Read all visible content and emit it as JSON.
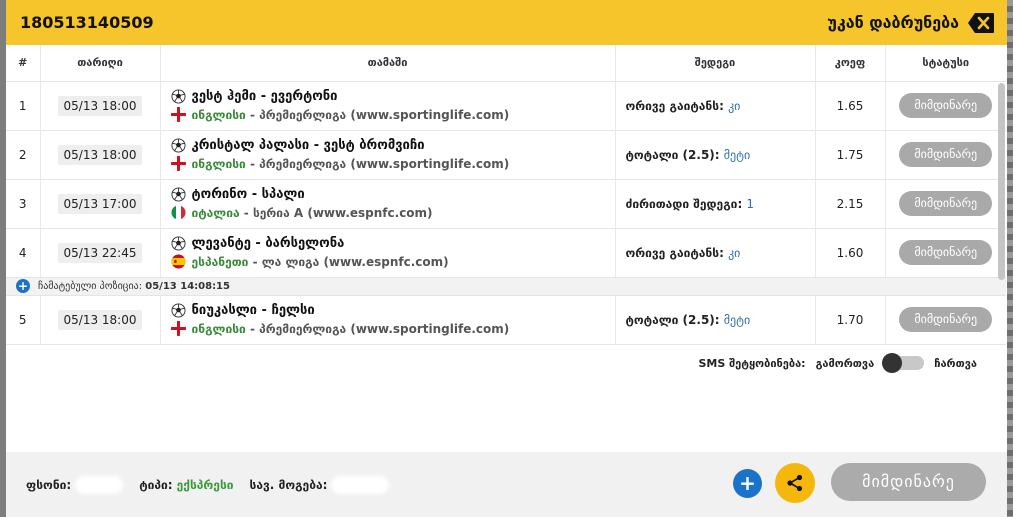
{
  "header": {
    "ticket_id": "180513140509",
    "back_label": "უკან დაბრუნება"
  },
  "columns": {
    "num": "#",
    "date": "თარიღი",
    "game": "თამაში",
    "outcome": "შედეგი",
    "odds": "კოეფ",
    "status": "სტატუსი"
  },
  "matches": [
    {
      "num": "1",
      "date": "05/13 18:00",
      "teams": "ვესტ ჰემი - ევერტონი",
      "country": "ინგლისი",
      "league": " - პრემიერლიგა (www.sportinglife.com)",
      "flag": "england",
      "market": "ორივე გაიტანს: ",
      "pick": "კი",
      "odds": "1.65",
      "status": "მიმდინარე"
    },
    {
      "num": "2",
      "date": "05/13 18:00",
      "teams": "კრისტალ პალასი - ვესტ ბრომვიჩი",
      "country": "ინგლისი",
      "league": " - პრემიერლიგა (www.sportinglife.com)",
      "flag": "england",
      "market": "ტოტალი (2.5): ",
      "pick": "მეტი",
      "odds": "1.75",
      "status": "მიმდინარე"
    },
    {
      "num": "3",
      "date": "05/13 17:00",
      "teams": "ტორინო - სპალი",
      "country": "იტალია",
      "league": " - სერია A (www.espnfc.com)",
      "flag": "italy",
      "market": "ძირითადი შედეგი: ",
      "pick": "1",
      "odds": "2.15",
      "status": "მიმდინარე"
    },
    {
      "num": "4",
      "date": "05/13 22:45",
      "teams": "ლევანტე - ბარსელონა",
      "country": "ესპანეთი",
      "league": " - ლა ლიგა (www.espnfc.com)",
      "flag": "spain",
      "market": "ორივე გაიტანს: ",
      "pick": "კი",
      "odds": "1.60",
      "status": "მიმდინარე"
    }
  ],
  "note": {
    "label": "ჩამატებული პოზიცია: ",
    "time": "05/13 14:08:15"
  },
  "match5": {
    "num": "5",
    "date": "05/13 18:00",
    "teams": "ნიუკასლი - ჩელსი",
    "country": "ინგლისი",
    "league": " - პრემიერლიგა (www.sportinglife.com)",
    "flag": "england",
    "market": "ტოტალი (2.5): ",
    "pick": "მეტი",
    "odds": "1.70",
    "status": "მიმდინარე"
  },
  "sms": {
    "label": "SMS შეტყობინება:",
    "off": "გამორთვა",
    "on": "ჩართვა"
  },
  "footer": {
    "stake_label": "ფსონი:",
    "type_label": "ტიპი:",
    "type_value": "ექსპრესი",
    "win_label": "სავ. მოგება:",
    "plus": "+",
    "status_button": "მიმდინარე"
  },
  "icons": {
    "back": "close-x-icon",
    "ball": "soccer-ball-icon",
    "share": "share-icon",
    "plus": "plus-icon"
  },
  "colors": {
    "header": "#f6c52c",
    "pill": "#a9a9a9",
    "accent_blue": "#1a73c9",
    "share": "#f6b70c"
  }
}
